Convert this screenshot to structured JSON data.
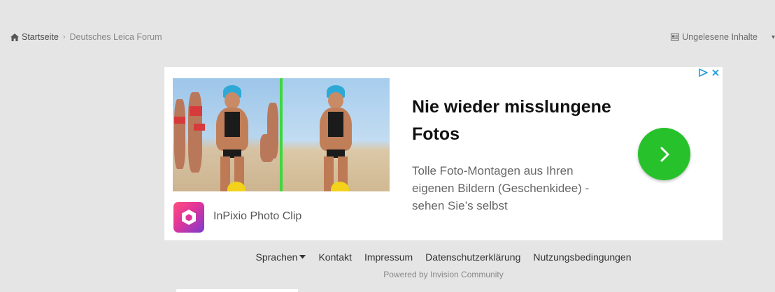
{
  "breadcrumb": {
    "home": "Startseite",
    "current": "Deutsches Leica Forum"
  },
  "header": {
    "unread_label": "Ungelesene Inhalte"
  },
  "ad": {
    "title": "Nie wieder misslungene Fotos",
    "description": "Tolle Foto-Montagen aus Ihren eigenen Bildern (Geschenkidee) - sehen Sie’s selbst",
    "app_name": "InPixio Photo Clip",
    "accent_color": "#27c22b",
    "icons": [
      "adchoices-icon",
      "close-icon",
      "chevron-right-icon",
      "app-logo"
    ]
  },
  "footer": {
    "links": [
      "Sprachen",
      "Kontakt",
      "Impressum",
      "Datenschutzerklärung",
      "Nutzungsbedingungen"
    ],
    "powered_by": "Powered by Invision Community"
  }
}
